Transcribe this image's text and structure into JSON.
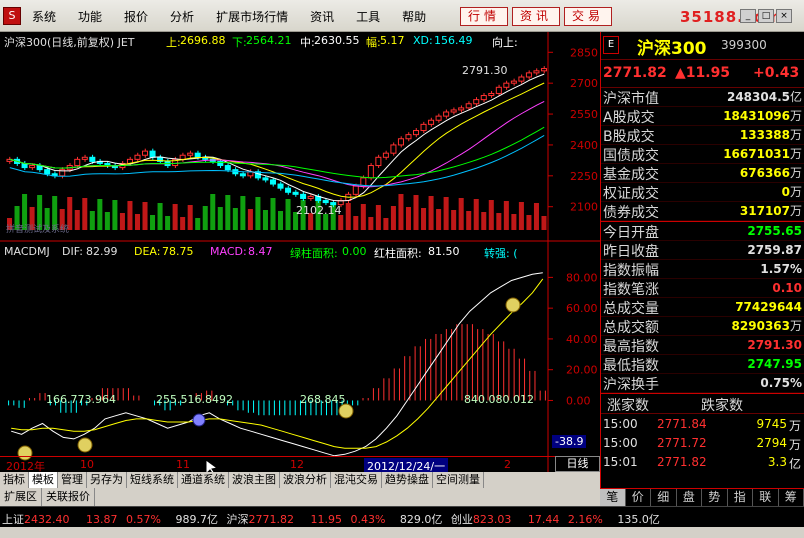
{
  "menu": {
    "items": [
      "系统",
      "功能",
      "报价",
      "分析",
      "扩展市场行情",
      "资讯",
      "工具",
      "帮助"
    ],
    "right_buttons": [
      "行情",
      "资讯",
      "交易"
    ],
    "brand": "35188.com"
  },
  "chart_header": {
    "title": "沪深300(日线,前复权) JET",
    "up_label": "上:",
    "up_value": "2696.88",
    "down_label": "下:",
    "down_value": "2564.21",
    "mid_label": "中:",
    "mid_value": "2630.55",
    "amp_label": "幅:",
    "amp_value": "5.17",
    "xd_label": "XD:",
    "xd_value": "156.49",
    "dir_label": "向上:"
  },
  "chart_annotations": {
    "high_label": "2791.30",
    "low_label": "2102.14",
    "watermark": "拼音测试及系统"
  },
  "macd_header": {
    "name": "MACDMJ",
    "dif_label": "DIF:",
    "dif_value": "82.99",
    "dea_label": "DEA:",
    "dea_value": "78.75",
    "macd_label": "MACD:",
    "macd_value": "8.47",
    "green_label": "绿柱面积:",
    "green_value": "0.00",
    "red_label": "红柱面积:",
    "red_value": "81.50",
    "strength_label": "转强: (",
    "area1": "166.773.964",
    "area2": "255.516.8492",
    "area3": "268.845",
    "area4": "840.080.012",
    "cursor_value": "-38.9"
  },
  "chart_data": [
    {
      "type": "line",
      "title": "沪深300(日线,前复权) JET",
      "y_ticks": [
        2100,
        2250,
        2400,
        2550,
        2700,
        2850
      ],
      "ylim": [
        2050,
        2900
      ],
      "x_labels": [
        "2012年",
        "10",
        "11",
        "12",
        "2012/12/24/一",
        "2"
      ],
      "close": [
        2330,
        2310,
        2290,
        2300,
        2280,
        2260,
        2250,
        2280,
        2300,
        2330,
        2340,
        2320,
        2310,
        2300,
        2290,
        2310,
        2330,
        2350,
        2370,
        2340,
        2320,
        2300,
        2330,
        2350,
        2360,
        2340,
        2330,
        2320,
        2300,
        2280,
        2260,
        2250,
        2270,
        2240,
        2230,
        2210,
        2190,
        2170,
        2160,
        2140,
        2150,
        2130,
        2120,
        2110,
        2130,
        2160,
        2200,
        2240,
        2300,
        2340,
        2360,
        2400,
        2430,
        2450,
        2470,
        2500,
        2520,
        2540,
        2560,
        2570,
        2580,
        2600,
        2620,
        2640,
        2650,
        2680,
        2700,
        2710,
        2730,
        2750,
        2760,
        2771
      ]
    },
    {
      "type": "bar",
      "title": "MACDMJ",
      "y_ticks": [
        0.0,
        20.0,
        40.0,
        60.0,
        80.0
      ],
      "ylim": [
        -40,
        90
      ],
      "dif": [
        -20,
        -22,
        -18,
        -15,
        -20,
        -24,
        -25,
        -22,
        -18,
        -12,
        -10,
        -8,
        -10,
        -12,
        -15,
        -18,
        -16,
        -14,
        -10,
        -8,
        -12,
        -15,
        -18,
        -20,
        -22,
        -24,
        -26,
        -28,
        -30,
        -32,
        -34,
        -36,
        -35,
        -33,
        -30,
        -25,
        -18,
        -10,
        0,
        10,
        20,
        30,
        40,
        50,
        58,
        64,
        70,
        74,
        78,
        80,
        82,
        83
      ],
      "dea": [
        -18,
        -19,
        -19,
        -18,
        -18,
        -19,
        -20,
        -20,
        -19,
        -17,
        -15,
        -13,
        -12,
        -12,
        -13,
        -14,
        -14,
        -14,
        -13,
        -12,
        -12,
        -13,
        -14,
        -15,
        -16,
        -18,
        -20,
        -22,
        -24,
        -26,
        -28,
        -30,
        -31,
        -31,
        -31,
        -30,
        -27,
        -23,
        -18,
        -12,
        -5,
        3,
        11,
        19,
        27,
        35,
        43,
        50,
        57,
        63,
        70,
        79
      ],
      "hist": [
        -2,
        -3,
        1,
        3,
        -2,
        -5,
        -5,
        -2,
        1,
        5,
        5,
        5,
        2,
        0,
        -2,
        -4,
        -2,
        0,
        3,
        4,
        0,
        -2,
        -4,
        -5,
        -6,
        -6,
        -6,
        -6,
        -6,
        -6,
        -6,
        -6,
        -4,
        -2,
        1,
        5,
        9,
        13,
        18,
        22,
        25,
        27,
        29,
        31,
        31,
        29,
        27,
        24,
        21,
        17,
        12,
        4
      ]
    }
  ],
  "right_panel": {
    "name": "沪深300",
    "code": "399300",
    "price": "2771.82",
    "change": "▲11.95",
    "change_pct": "+0.43",
    "rows": [
      {
        "label": "沪深市值",
        "value": "248304.5",
        "unit": "亿",
        "color": "#e0e0e0"
      },
      {
        "label": "A股成交",
        "value": "18431096",
        "unit": "万",
        "color": "#ffff00"
      },
      {
        "label": "B股成交",
        "value": "133388",
        "unit": "万",
        "color": "#ffff00"
      },
      {
        "label": "国债成交",
        "value": "16671031",
        "unit": "万",
        "color": "#ffff00"
      },
      {
        "label": "基金成交",
        "value": "676366",
        "unit": "万",
        "color": "#ffff00"
      },
      {
        "label": "权证成交",
        "value": "0",
        "unit": "万",
        "color": "#ffff00"
      },
      {
        "label": "债券成交",
        "value": "317107",
        "unit": "万",
        "color": "#ffff00"
      }
    ],
    "rows2": [
      {
        "label": "今日开盘",
        "value": "2755.65",
        "color": "#00ff00"
      },
      {
        "label": "昨日收盘",
        "value": "2759.87",
        "color": "#e0e0e0"
      },
      {
        "label": "指数振幅",
        "value": "1.57%",
        "color": "#e0e0e0"
      },
      {
        "label": "指数笔涨",
        "value": "0.10",
        "color": "#ff3030"
      },
      {
        "label": "总成交量",
        "value": "77429644",
        "color": "#ffff00"
      },
      {
        "label": "总成交额",
        "value": "8290363",
        "unit": "万",
        "color": "#ffff00"
      },
      {
        "label": "最高指数",
        "value": "2791.30",
        "color": "#ff3030"
      },
      {
        "label": "最低指数",
        "value": "2747.95",
        "color": "#00ff00"
      },
      {
        "label": "沪深换手",
        "value": "0.75%",
        "color": "#e0e0e0"
      }
    ],
    "trade_head": [
      "涨家数",
      "跌家数"
    ],
    "trades": [
      {
        "time": "15:00",
        "price": "2771.84",
        "vol": "9745",
        "unit": "万"
      },
      {
        "time": "15:00",
        "price": "2771.72",
        "vol": "2794",
        "unit": "万"
      },
      {
        "time": "15:01",
        "price": "2771.82",
        "vol": "3.3",
        "unit": "亿"
      }
    ],
    "tabs": [
      "笔",
      "价",
      "细",
      "盘",
      "势",
      "指",
      "联",
      "筹"
    ]
  },
  "xaxis": {
    "labels": [
      "2012年",
      "10",
      "11",
      "12",
      "2",
      "日线"
    ],
    "cursor_date": "2012/12/24/一"
  },
  "tabbar": [
    "指标",
    "模板",
    "管理",
    "另存为",
    "短线系统",
    "通道系统",
    "波浪主图",
    "波浪分析",
    "混沌交易",
    "趋势操盘",
    "空间测量"
  ],
  "tabbar2": [
    "扩展区",
    "关联报价"
  ],
  "statusbar": {
    "sh_label": "上证",
    "sh_value": "2432.40",
    "sh_chg": "13.87",
    "sh_pct": "0.57%",
    "sh_amt": "989.7亿",
    "hs_label": "沪深",
    "hs_value": "2771.82",
    "hs_chg": "11.95",
    "hs_pct": "0.43%",
    "hs_amt": "829.0亿",
    "cy_label": "创业",
    "cy_value": "823.03",
    "cy_chg": "17.44",
    "cy_pct": "2.16%",
    "cy_amt": "135.0亿"
  }
}
